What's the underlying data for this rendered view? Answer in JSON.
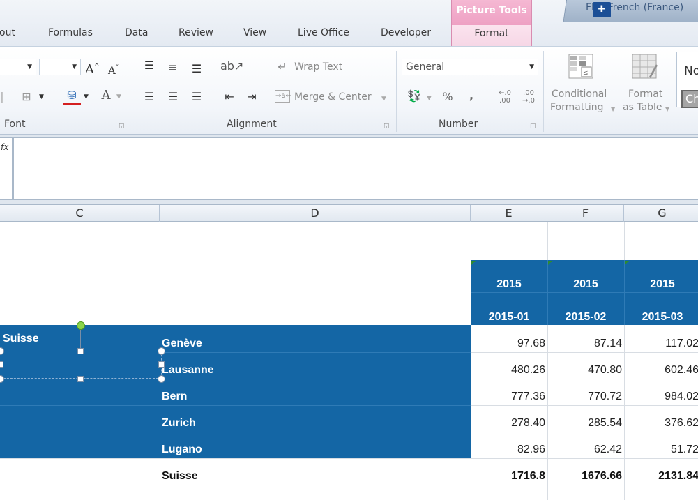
{
  "tabs": {
    "layout_partial": "out",
    "formulas": "Formulas",
    "data": "Data",
    "review": "Review",
    "view": "View",
    "live_office": "Live Office",
    "developer": "Developer",
    "picture_tools": "Picture Tools",
    "format": "Format"
  },
  "language_bar": {
    "text": "FR - French (France)",
    "icon": "language-icon"
  },
  "ribbon": {
    "font_group_label": "Font",
    "alignment_group_label": "Alignment",
    "number_group_label": "Number",
    "wrap_text": "Wrap Text",
    "merge_center": "Merge & Center",
    "number_format": "General",
    "percent": "%",
    "comma": ",",
    "conditional_formatting": [
      "Conditional",
      "Formatting"
    ],
    "format_as_table": [
      "Format",
      "as Table"
    ],
    "styles_partial_1": "No",
    "styles_partial_2": "Ch"
  },
  "formula_bar": {
    "fx_label": "fx",
    "value": ""
  },
  "columns": [
    "C",
    "D",
    "E",
    "F",
    "G"
  ],
  "sheet": {
    "year_headers": [
      "2015",
      "2015",
      "2015"
    ],
    "month_headers": [
      "2015-01",
      "2015-02",
      "2015-03"
    ],
    "region": "Suisse",
    "rows": [
      {
        "city": "Genève",
        "values": [
          "97.68",
          "87.14",
          "117.02"
        ]
      },
      {
        "city": "Lausanne",
        "values": [
          "480.26",
          "470.80",
          "602.46"
        ]
      },
      {
        "city": "Bern",
        "values": [
          "777.36",
          "770.72",
          "984.02"
        ]
      },
      {
        "city": "Zurich",
        "values": [
          "278.40",
          "285.54",
          "376.62"
        ]
      },
      {
        "city": "Lugano",
        "values": [
          "82.96",
          "62.42",
          "51.72"
        ]
      }
    ],
    "total": {
      "label": "Suisse",
      "values": [
        "1716.8",
        "1676.66",
        "2131.84"
      ]
    }
  },
  "colors": {
    "header_blue": "#1466a5",
    "picture_tools_pink": "#eea0c3"
  }
}
